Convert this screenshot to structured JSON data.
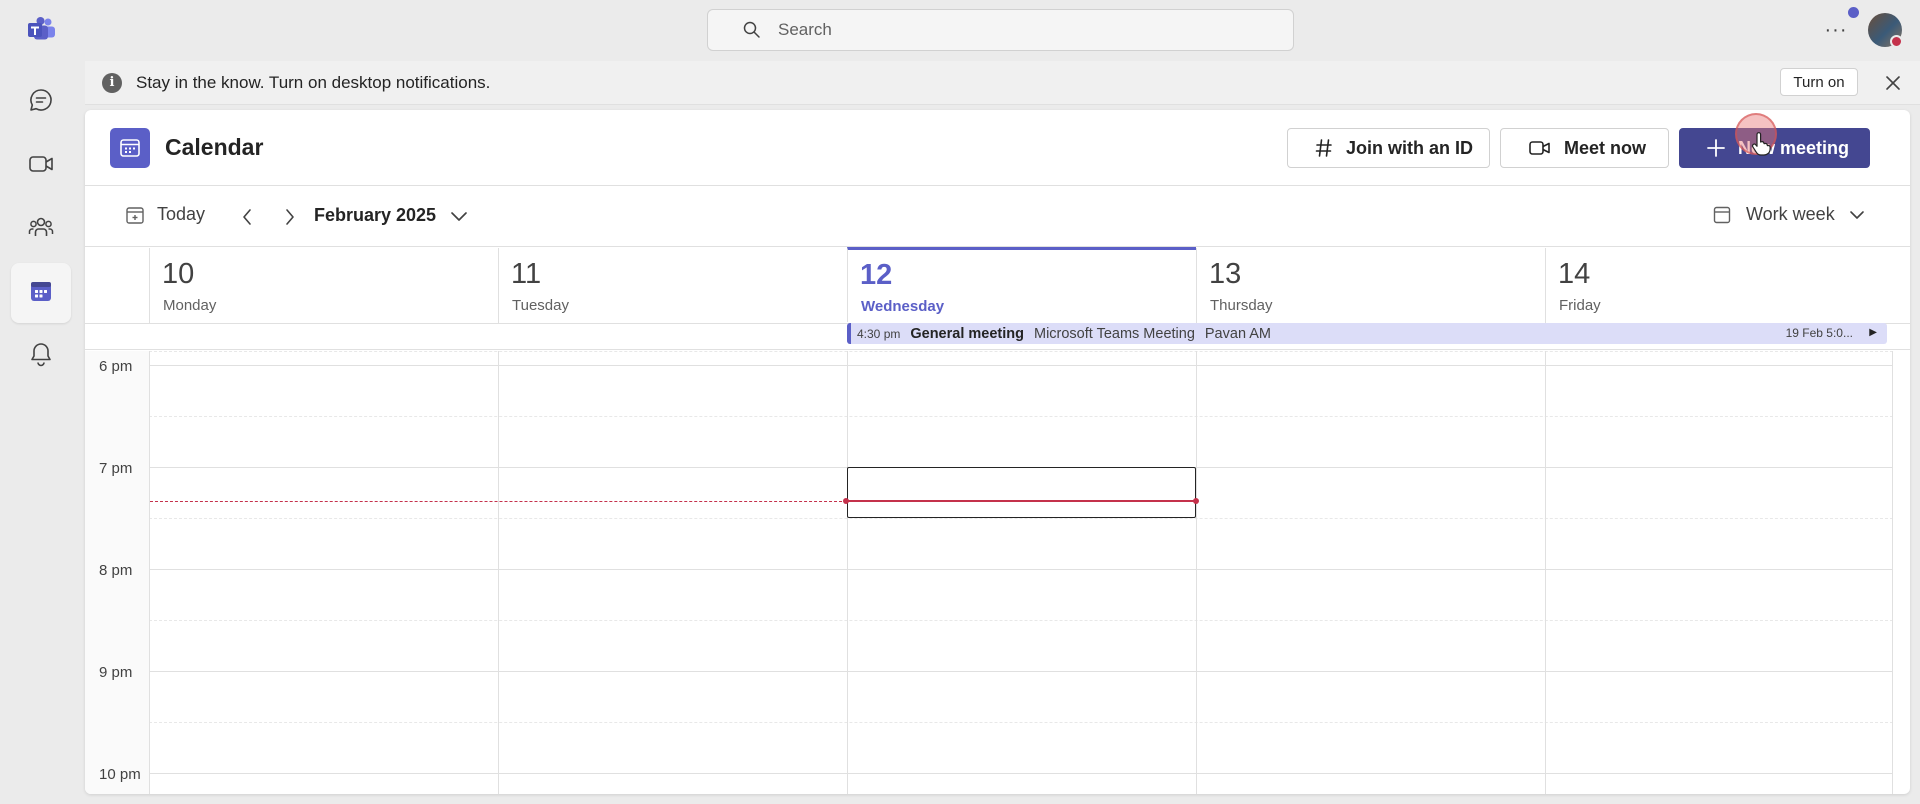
{
  "search": {
    "placeholder": "Search"
  },
  "banner": {
    "message": "Stay in the know. Turn on desktop notifications.",
    "turn_on_label": "Turn on"
  },
  "header": {
    "title": "Calendar",
    "join_label": "Join with an ID",
    "meet_label": "Meet now",
    "new_meeting_label": "New meeting"
  },
  "toolbar": {
    "today_label": "Today",
    "month_label": "February 2025",
    "view_label": "Work week"
  },
  "days": [
    {
      "num": "10",
      "name": "Monday"
    },
    {
      "num": "11",
      "name": "Tuesday"
    },
    {
      "num": "12",
      "name": "Wednesday"
    },
    {
      "num": "13",
      "name": "Thursday"
    },
    {
      "num": "14",
      "name": "Friday"
    }
  ],
  "event": {
    "time": "4:30 pm",
    "title": "General meeting",
    "location": "Microsoft Teams Meeting",
    "organizer": "Pavan AM",
    "end": "19 Feb 5:0..."
  },
  "hours": [
    "6 pm",
    "7 pm",
    "8 pm",
    "9 pm",
    "10 pm"
  ],
  "colors": {
    "brand": "#5b5fc7",
    "primary_button": "#444791",
    "now_line": "#c4314b"
  }
}
